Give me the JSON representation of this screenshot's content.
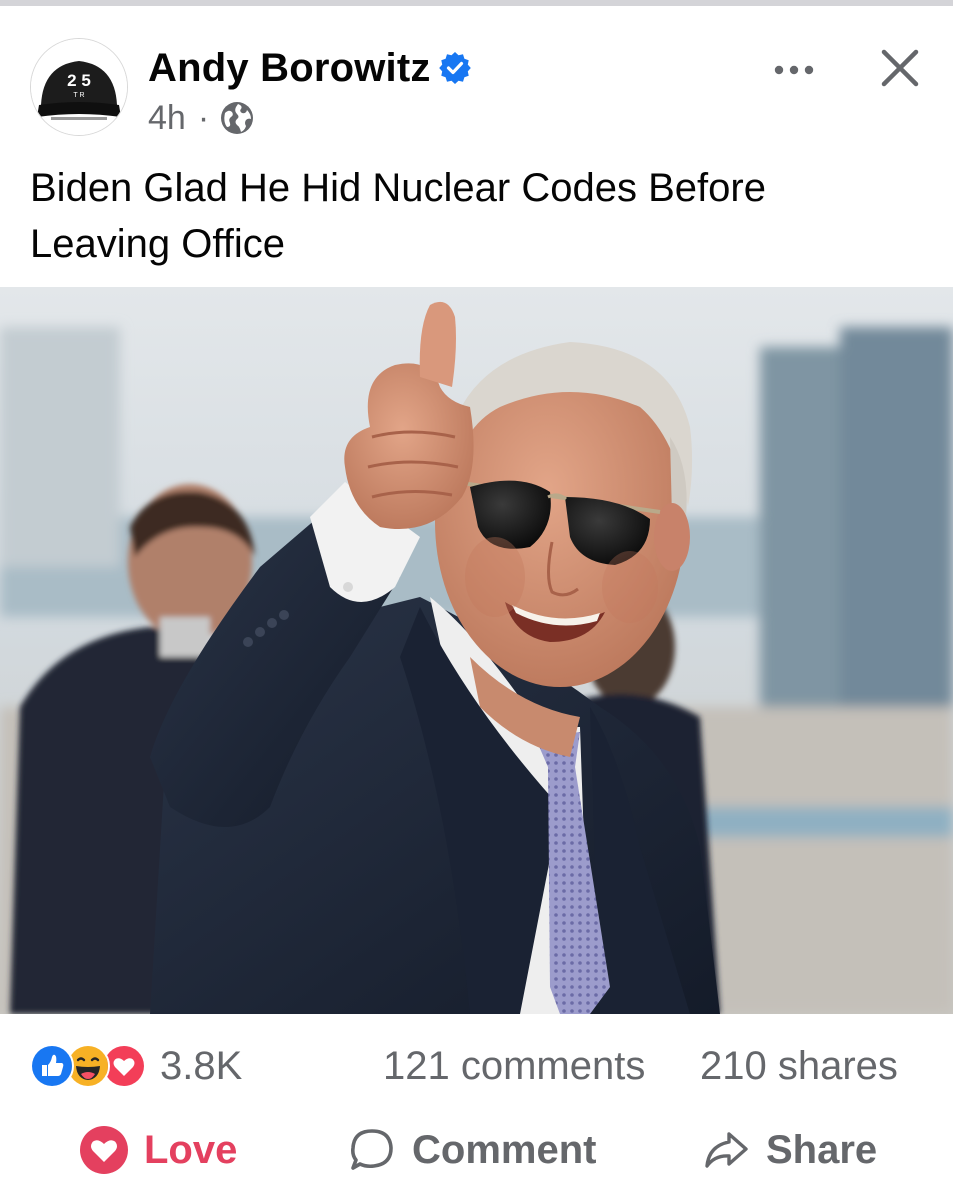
{
  "post": {
    "author": "Andy Borowitz",
    "verified_icon": "verified-badge-icon",
    "timestamp": "4h",
    "separator": "·",
    "audience_icon": "globe-icon",
    "text": "Biden Glad He Hid Nuclear Codes Before Leaving Office",
    "avatar_text": "2 5",
    "avatar_small_text": "T R",
    "more_icon": "more-dots-icon",
    "close_icon": "close-icon"
  },
  "stats": {
    "reactions": [
      "like",
      "haha",
      "love"
    ],
    "reaction_count": "3.8K",
    "comments": "121 comments",
    "shares": "210 shares"
  },
  "actions": {
    "love_label": "Love",
    "comment_label": "Comment",
    "share_label": "Share"
  },
  "colors": {
    "love": "#e4405f",
    "verified": "#1877f2",
    "secondary_text": "#65676b"
  }
}
